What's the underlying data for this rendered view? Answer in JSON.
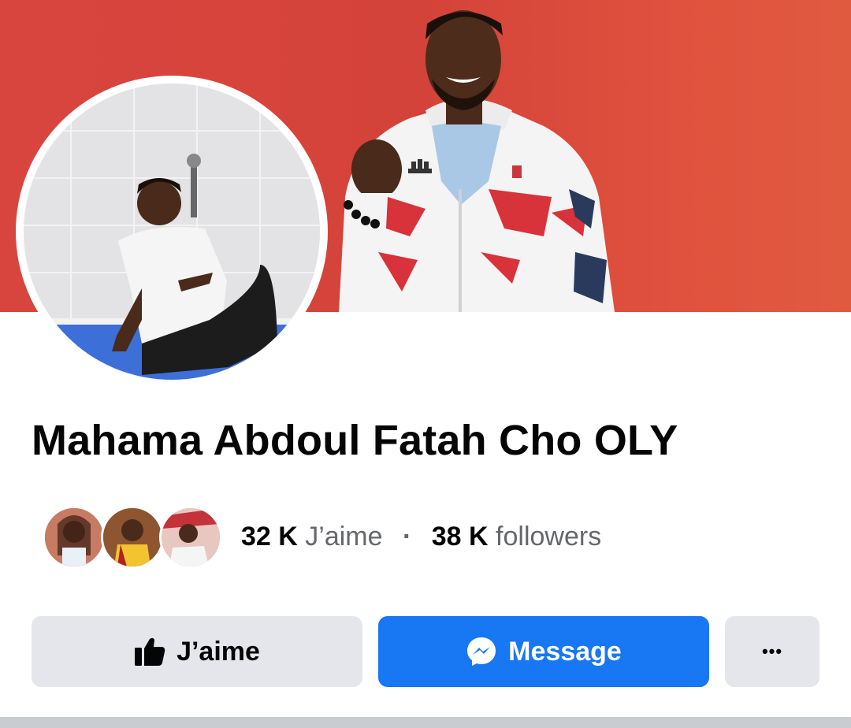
{
  "profile": {
    "name": "Mahama Abdoul Fatah Cho OLY"
  },
  "stats": {
    "likes_count": "32 K",
    "likes_label": "J’aime",
    "separator": "·",
    "followers_count": "38 K",
    "followers_label": "followers"
  },
  "actions": {
    "like_label": "J’aime",
    "message_label": "Message",
    "more_label": "•••"
  },
  "colors": {
    "primary": "#1877f2",
    "secondary_button": "#e4e6eb",
    "cover": "#d8453f"
  },
  "icons": {
    "like": "thumbs-up-icon",
    "message": "messenger-icon",
    "more": "more-dots-icon"
  }
}
